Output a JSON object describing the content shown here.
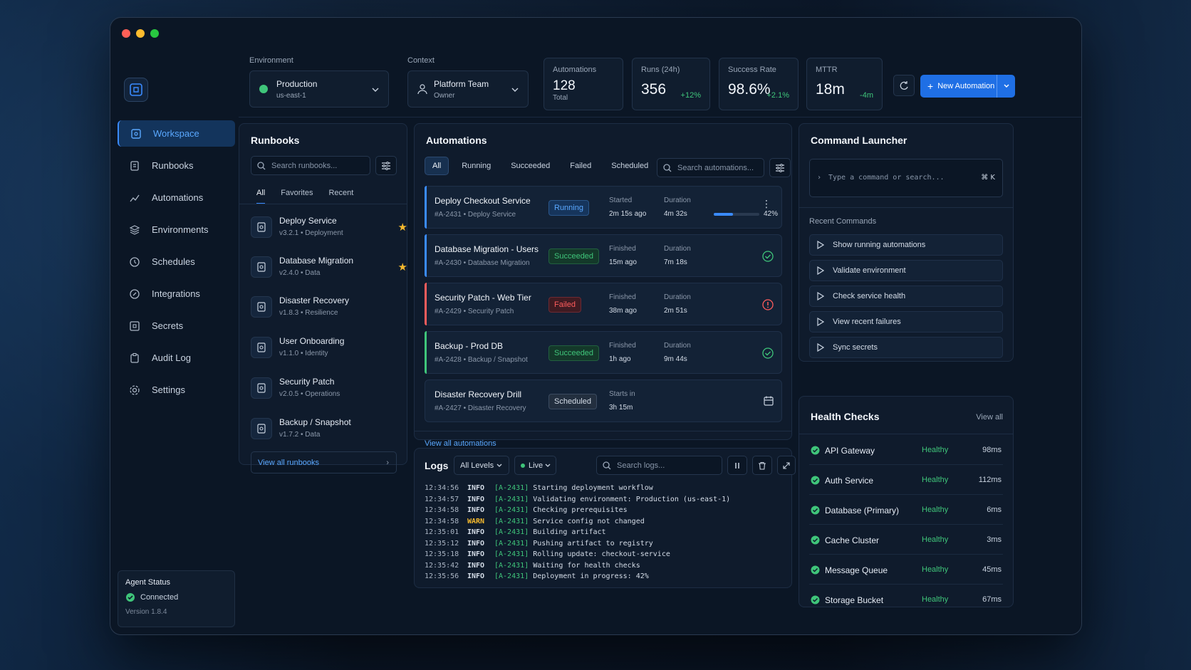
{
  "sidebar": {
    "items": [
      {
        "label": "Workspace",
        "icon": "workspace-icon",
        "active": true
      },
      {
        "label": "Runbooks",
        "icon": "runbooks-icon"
      },
      {
        "label": "Automations",
        "icon": "automations-icon"
      },
      {
        "label": "Environments",
        "icon": "layers-icon"
      },
      {
        "label": "Schedules",
        "icon": "clock-icon"
      },
      {
        "label": "Integrations",
        "icon": "plug-icon"
      },
      {
        "label": "Secrets",
        "icon": "lock-icon"
      },
      {
        "label": "Audit Log",
        "icon": "clipboard-icon"
      },
      {
        "label": "Settings",
        "icon": "gear-icon"
      }
    ],
    "agent": {
      "title": "Agent Status",
      "status": "Connected",
      "version": "Version 1.8.4"
    }
  },
  "topbar": {
    "environment": {
      "label": "Environment",
      "value": "Production",
      "sub": "us-east-1"
    },
    "context": {
      "label": "Context",
      "value": "Platform Team",
      "sub": "Owner"
    },
    "stats": [
      {
        "label": "Automations",
        "value": "128",
        "sub": "Total",
        "delta": ""
      },
      {
        "label": "Runs (24h)",
        "value": "356",
        "sub": "",
        "delta": "+12%"
      },
      {
        "label": "Success Rate",
        "value": "98.6%",
        "sub": "",
        "delta": "+2.1%"
      },
      {
        "label": "MTTR",
        "value": "18m",
        "sub": "",
        "delta": "-4m"
      }
    ],
    "new_button": "New Automation"
  },
  "runbooks": {
    "title": "Runbooks",
    "search_placeholder": "Search runbooks...",
    "tabs": [
      "All",
      "Favorites",
      "Recent"
    ],
    "items": [
      {
        "name": "Deploy Service",
        "meta": "v3.2.1  •  Deployment",
        "fav": true
      },
      {
        "name": "Database Migration",
        "meta": "v2.4.0  •  Data",
        "fav": true
      },
      {
        "name": "Disaster Recovery",
        "meta": "v1.8.3  •  Resilience",
        "fav": false
      },
      {
        "name": "User Onboarding",
        "meta": "v1.1.0  •  Identity",
        "fav": false
      },
      {
        "name": "Security Patch",
        "meta": "v2.0.5  •  Operations",
        "fav": false
      },
      {
        "name": "Backup / Snapshot",
        "meta": "v1.7.2  •  Data",
        "fav": false
      }
    ],
    "view_all": "View all runbooks"
  },
  "automations": {
    "title": "Automations",
    "tabs": [
      "All",
      "Running",
      "Succeeded",
      "Failed",
      "Scheduled"
    ],
    "search_placeholder": "Search automations...",
    "rows": [
      {
        "name": "Deploy Checkout Service",
        "meta": "#A-2431  •  Deploy Service",
        "status": "Running",
        "k1": "Started",
        "v1": "2m 15s ago",
        "k2": "Duration",
        "v2": "4m 32s",
        "progress": "42%"
      },
      {
        "name": "Database Migration - Users",
        "meta": "#A-2430  •  Database Migration",
        "status": "Succeeded",
        "k1": "Finished",
        "v1": "15m ago",
        "k2": "Duration",
        "v2": "7m 18s"
      },
      {
        "name": "Security Patch - Web Tier",
        "meta": "#A-2429  •  Security Patch",
        "status": "Failed",
        "k1": "Finished",
        "v1": "38m ago",
        "k2": "Duration",
        "v2": "2m 51s"
      },
      {
        "name": "Backup - Prod DB",
        "meta": "#A-2428  •  Backup / Snapshot",
        "status": "Succeeded",
        "k1": "Finished",
        "v1": "1h ago",
        "k2": "Duration",
        "v2": "9m 44s"
      },
      {
        "name": "Disaster Recovery Drill",
        "meta": "#A-2427  •  Disaster Recovery",
        "status": "Scheduled",
        "k1": "Starts in",
        "v1": "3h 15m",
        "k2": "",
        "v2": ""
      }
    ],
    "view_all": "View all automations"
  },
  "logs": {
    "title": "Logs",
    "level": "All Levels",
    "live": "Live",
    "search_placeholder": "Search logs...",
    "lines": [
      {
        "ts": "12:34:56",
        "lv": "INFO",
        "id": "[A-2431]",
        "msg": "Starting deployment workflow"
      },
      {
        "ts": "12:34:57",
        "lv": "INFO",
        "id": "[A-2431]",
        "msg": "Validating environment: Production (us-east-1)"
      },
      {
        "ts": "12:34:58",
        "lv": "INFO",
        "id": "[A-2431]",
        "msg": "Checking prerequisites"
      },
      {
        "ts": "12:34:58",
        "lv": "WARN",
        "id": "[A-2431]",
        "msg": "Service config not changed"
      },
      {
        "ts": "12:35:01",
        "lv": "INFO",
        "id": "[A-2431]",
        "msg": "Building artifact"
      },
      {
        "ts": "12:35:12",
        "lv": "INFO",
        "id": "[A-2431]",
        "msg": "Pushing artifact to registry"
      },
      {
        "ts": "12:35:18",
        "lv": "INFO",
        "id": "[A-2431]",
        "msg": "Rolling update: checkout-service"
      },
      {
        "ts": "12:35:42",
        "lv": "INFO",
        "id": "[A-2431]",
        "msg": "Waiting for health checks"
      },
      {
        "ts": "12:35:56",
        "lv": "INFO",
        "id": "[A-2431]",
        "msg": "Deployment in progress: 42%"
      }
    ]
  },
  "launcher": {
    "title": "Command Launcher",
    "placeholder": "Type a command or search...",
    "shortcut": "⌘ K",
    "recent_title": "Recent Commands",
    "commands": [
      "Show running automations",
      "Validate environment",
      "Check service health",
      "View recent failures",
      "Sync secrets"
    ]
  },
  "health": {
    "title": "Health Checks",
    "view_all": "View all",
    "items": [
      {
        "name": "API Gateway",
        "status": "Healthy",
        "ms": "98ms"
      },
      {
        "name": "Auth Service",
        "status": "Healthy",
        "ms": "112ms"
      },
      {
        "name": "Database (Primary)",
        "status": "Healthy",
        "ms": "6ms"
      },
      {
        "name": "Cache Cluster",
        "status": "Healthy",
        "ms": "3ms"
      },
      {
        "name": "Message Queue",
        "status": "Healthy",
        "ms": "45ms"
      },
      {
        "name": "Storage Bucket",
        "status": "Healthy",
        "ms": "67ms"
      }
    ]
  },
  "colors": {
    "accent": "#3a8bff",
    "success": "#3fc57a",
    "warn": "#f5b92e",
    "danger": "#ff5c5c"
  }
}
